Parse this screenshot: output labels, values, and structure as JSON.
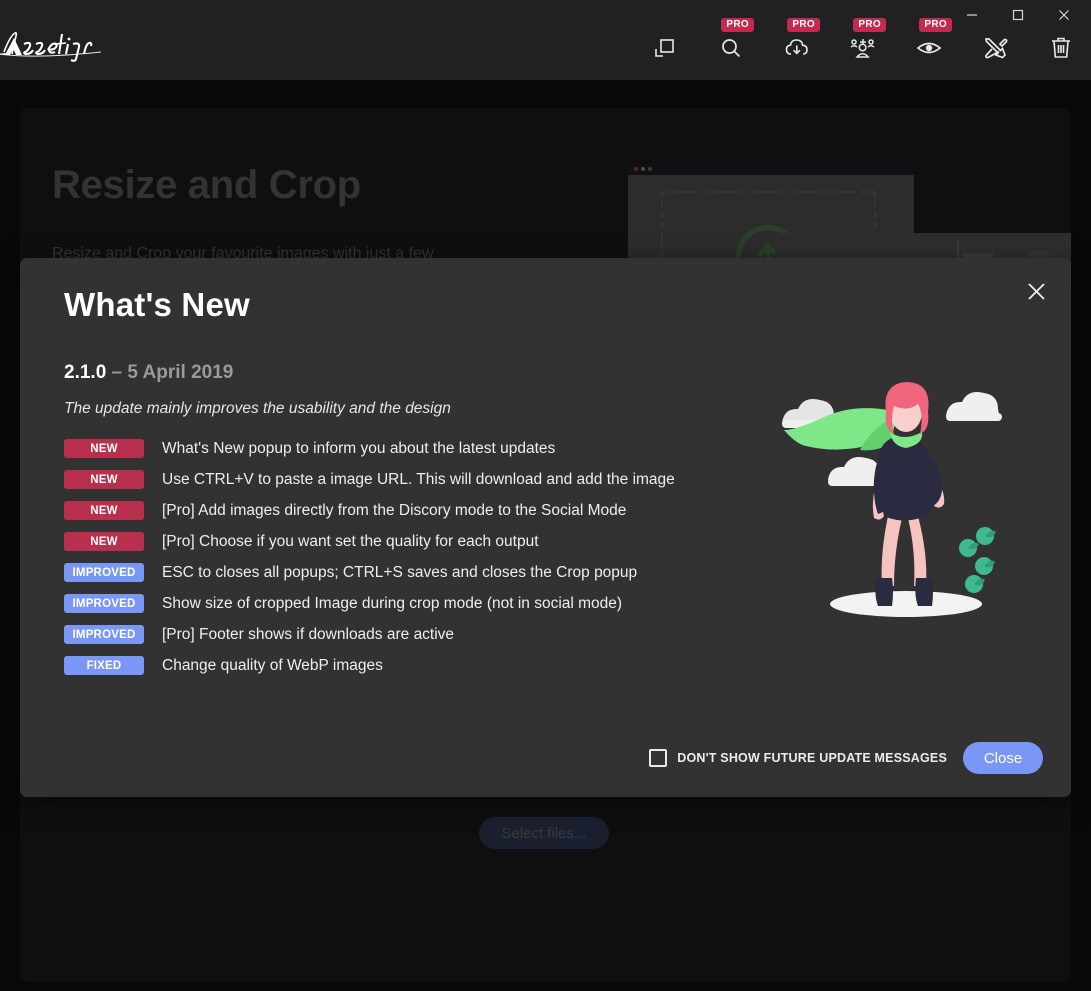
{
  "app": {
    "logo_text": "Assetizr"
  },
  "window_controls": {
    "minimize": "minimize-icon",
    "maximize": "maximize-icon",
    "close": "close-icon"
  },
  "toolbar": {
    "pro_badge_label": "PRO",
    "items": [
      {
        "name": "resize-crop-icon",
        "pro": false
      },
      {
        "name": "search-icon",
        "pro": true
      },
      {
        "name": "cloud-download-icon",
        "pro": true
      },
      {
        "name": "social-users-icon",
        "pro": true
      },
      {
        "name": "preview-eye-icon",
        "pro": true
      },
      {
        "name": "tools-icon",
        "pro": false
      },
      {
        "name": "trash-icon",
        "pro": false
      }
    ]
  },
  "page": {
    "title": "Resize and Crop",
    "subtitle": "Resize and Crop your favourite images with just a few",
    "select_files_label": "Select files..."
  },
  "modal": {
    "title": "What's New",
    "version": "2.1.0",
    "version_separator": " – ",
    "date": "5 April 2019",
    "note": "The update mainly improves the usability and the design",
    "changes": [
      {
        "tag": "NEW",
        "type": "new",
        "text": "What's New popup to inform you about the latest updates"
      },
      {
        "tag": "NEW",
        "type": "new",
        "text": "Use CTRL+V to paste a image URL. This will download and add the image"
      },
      {
        "tag": "NEW",
        "type": "new",
        "text": "[Pro] Add images directly from the Discory mode to the Social Mode"
      },
      {
        "tag": "NEW",
        "type": "new",
        "text": "[Pro] Choose if you want set the quality for each output"
      },
      {
        "tag": "IMPROVED",
        "type": "improved",
        "text": "ESC to closes all popups; CTRL+S saves and closes the Crop popup"
      },
      {
        "tag": "IMPROVED",
        "type": "improved",
        "text": "Show size of cropped Image during crop mode (not in social mode)"
      },
      {
        "tag": "IMPROVED",
        "type": "improved",
        "text": "[Pro] Footer shows if downloads are active"
      },
      {
        "tag": "FIXED",
        "type": "fixed",
        "text": "Change quality of WebP images"
      }
    ],
    "dont_show_label": "DON'T SHOW FUTURE UPDATE MESSAGES",
    "dont_show_checked": false,
    "close_button_label": "Close"
  },
  "colors": {
    "badge_new": "#b8304e",
    "badge_improved": "#7b97f5",
    "pro_badge": "#c42a4e",
    "accent_button": "#7b97f5",
    "titlebar_bg": "#212123",
    "panel_bg": "#1b1b1c",
    "modal_bg": "#323233",
    "cape_green": "#7ee787",
    "hair_pink": "#f2657f"
  }
}
